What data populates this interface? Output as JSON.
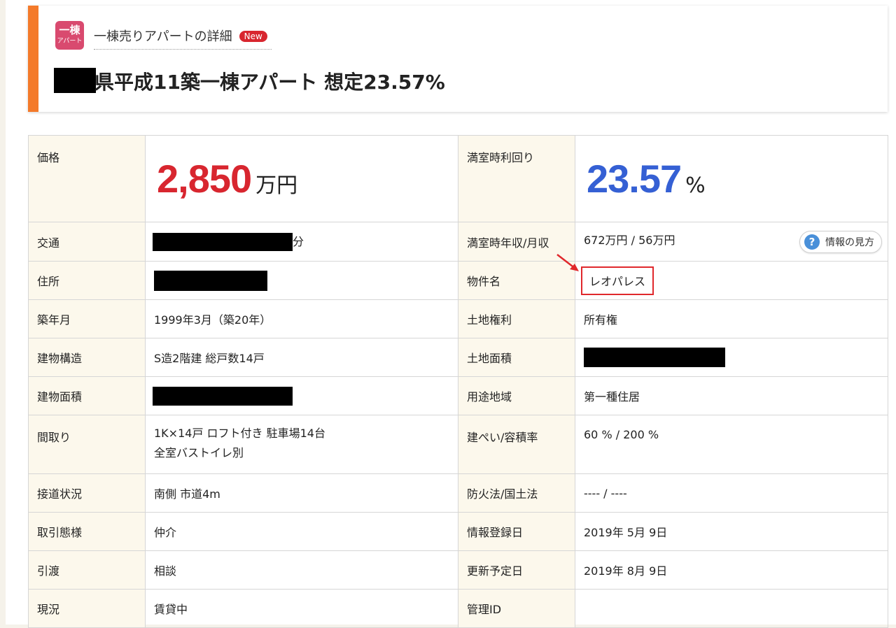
{
  "header": {
    "category_icon_big": "一棟",
    "category_icon_small": "アパート",
    "category_label": "一棟売りアパートの詳細",
    "new_badge": "New",
    "title_text": "県平成11築一棟アパート 想定23.57%"
  },
  "colors": {
    "accent_orange": "#f47a2a",
    "price_red": "#d8262f",
    "yield_blue": "#3560d4",
    "label_bg": "#fcf8ec",
    "highlight_red": "#e0282c"
  },
  "table": {
    "price_label": "価格",
    "price_value": "2,850",
    "price_unit": "万円",
    "yield_label": "満室時利回り",
    "yield_value": "23.57",
    "yield_unit": "%",
    "access_label": "交通",
    "access_value_tail": "分",
    "income_label": "満室時年収/月収",
    "income_value": "672万円 / 56万円",
    "help_button": "情報の見方",
    "address_label": "住所",
    "name_label": "物件名",
    "name_value": "レオパレス",
    "built_label": "築年月",
    "built_value": "1999年3月（築20年）",
    "land_right_label": "土地権利",
    "land_right_value": "所有権",
    "structure_label": "建物構造",
    "structure_value": "S造2階建 総戸数14戸",
    "land_area_label": "土地面積",
    "building_area_label": "建物面積",
    "zoning_label": "用途地域",
    "zoning_value": "第一種住居",
    "layout_label": "間取り",
    "layout_value_1": "1K×14戸 ロフト付き 駐車場14台",
    "layout_value_2": "全室バストイレ別",
    "coverage_label": "建ぺい/容積率",
    "coverage_value": "60 % / 200 %",
    "road_label": "接道状況",
    "road_value": "南側 市道4m",
    "fire_label": "防火法/国土法",
    "fire_value": "---- / ----",
    "deal_label": "取引態様",
    "deal_value": "仲介",
    "registered_label": "情報登録日",
    "registered_value": "2019年 5月 9日",
    "handover_label": "引渡",
    "handover_value": "相談",
    "update_label": "更新予定日",
    "update_value": "2019年 8月 9日",
    "status_label": "現況",
    "status_value": "賃貸中",
    "mgmt_label": "管理ID",
    "mgmt_value": ""
  }
}
